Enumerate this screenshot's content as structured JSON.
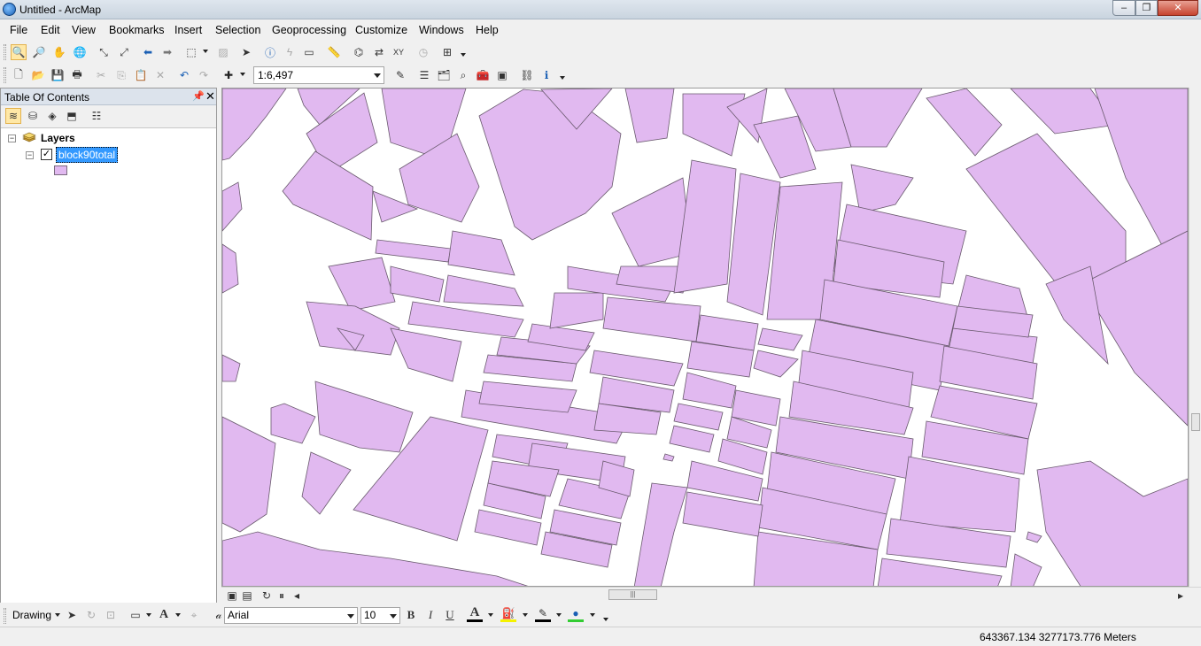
{
  "window": {
    "title": "Untitled - ArcMap"
  },
  "menu": [
    "File",
    "Edit",
    "View",
    "Bookmarks",
    "Insert",
    "Selection",
    "Geoprocessing",
    "Customize",
    "Windows",
    "Help"
  ],
  "standard_toolbar": {
    "map_scale": "1:6,497"
  },
  "toc": {
    "title": "Table Of Contents",
    "root_label": "Layers",
    "layer": {
      "name": "block90total",
      "checked": true,
      "fill_color": "#e1b9f0"
    }
  },
  "map": {
    "fill_color": "#e1b9f0",
    "outline_color": "#6a5a6e"
  },
  "drawing_toolbar": {
    "drawing_label": "Drawing",
    "font_name": "Arial",
    "font_size": "10",
    "bold": "B",
    "italic": "I",
    "underline": "U",
    "font_color_label": "A",
    "text_tool_label": "A"
  },
  "status": {
    "coordinates": "643367.134  3277173.776 Meters"
  }
}
